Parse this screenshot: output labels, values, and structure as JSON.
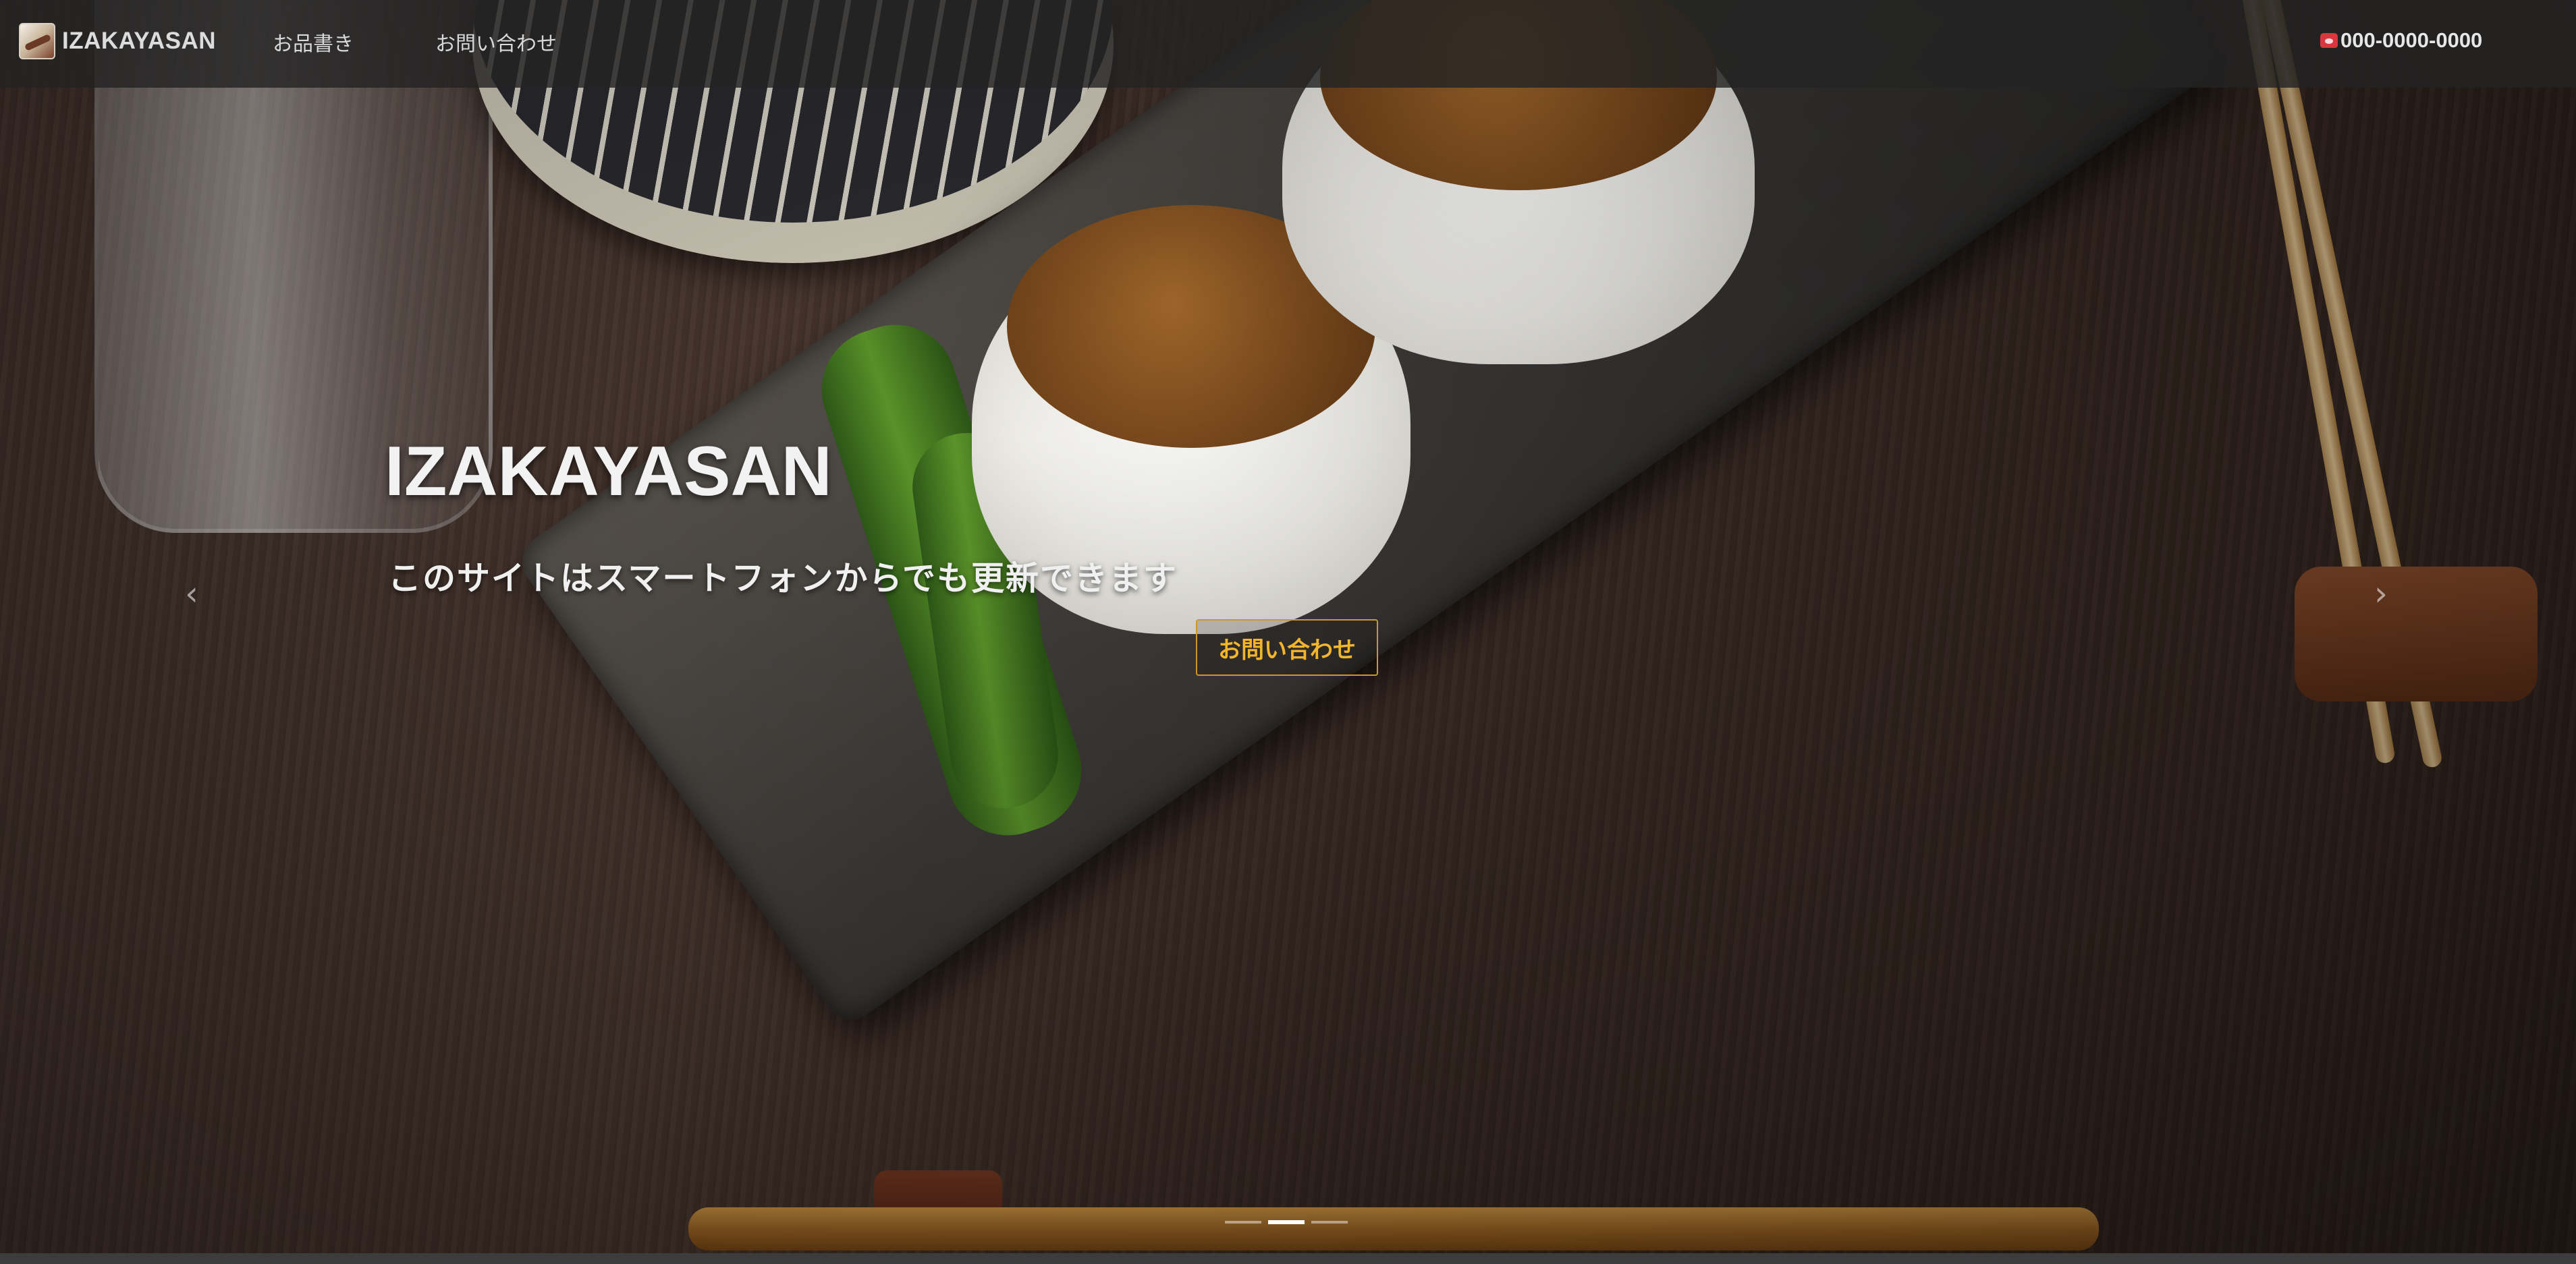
{
  "navbar": {
    "brand": "IZAKAYASAN",
    "links": [
      {
        "label": "お品書き"
      },
      {
        "label": "お問い合わせ"
      }
    ],
    "phone": "000-0000-0000",
    "phone_icon": "phone-icon"
  },
  "hero": {
    "title": "IZAKAYASAN",
    "subtitle": "このサイトはスマートフォンからでも更新できます",
    "cta_label": "お問い合わせ",
    "prev_icon": "chevron-left-icon",
    "next_icon": "chevron-right-icon",
    "prev_glyph": "‹",
    "next_glyph": "›",
    "slide_count": 3,
    "active_slide": 2
  },
  "colors": {
    "navbar_bg": "#232323",
    "cta_accent": "#f3b52a",
    "phone_icon": "#d9363e"
  }
}
